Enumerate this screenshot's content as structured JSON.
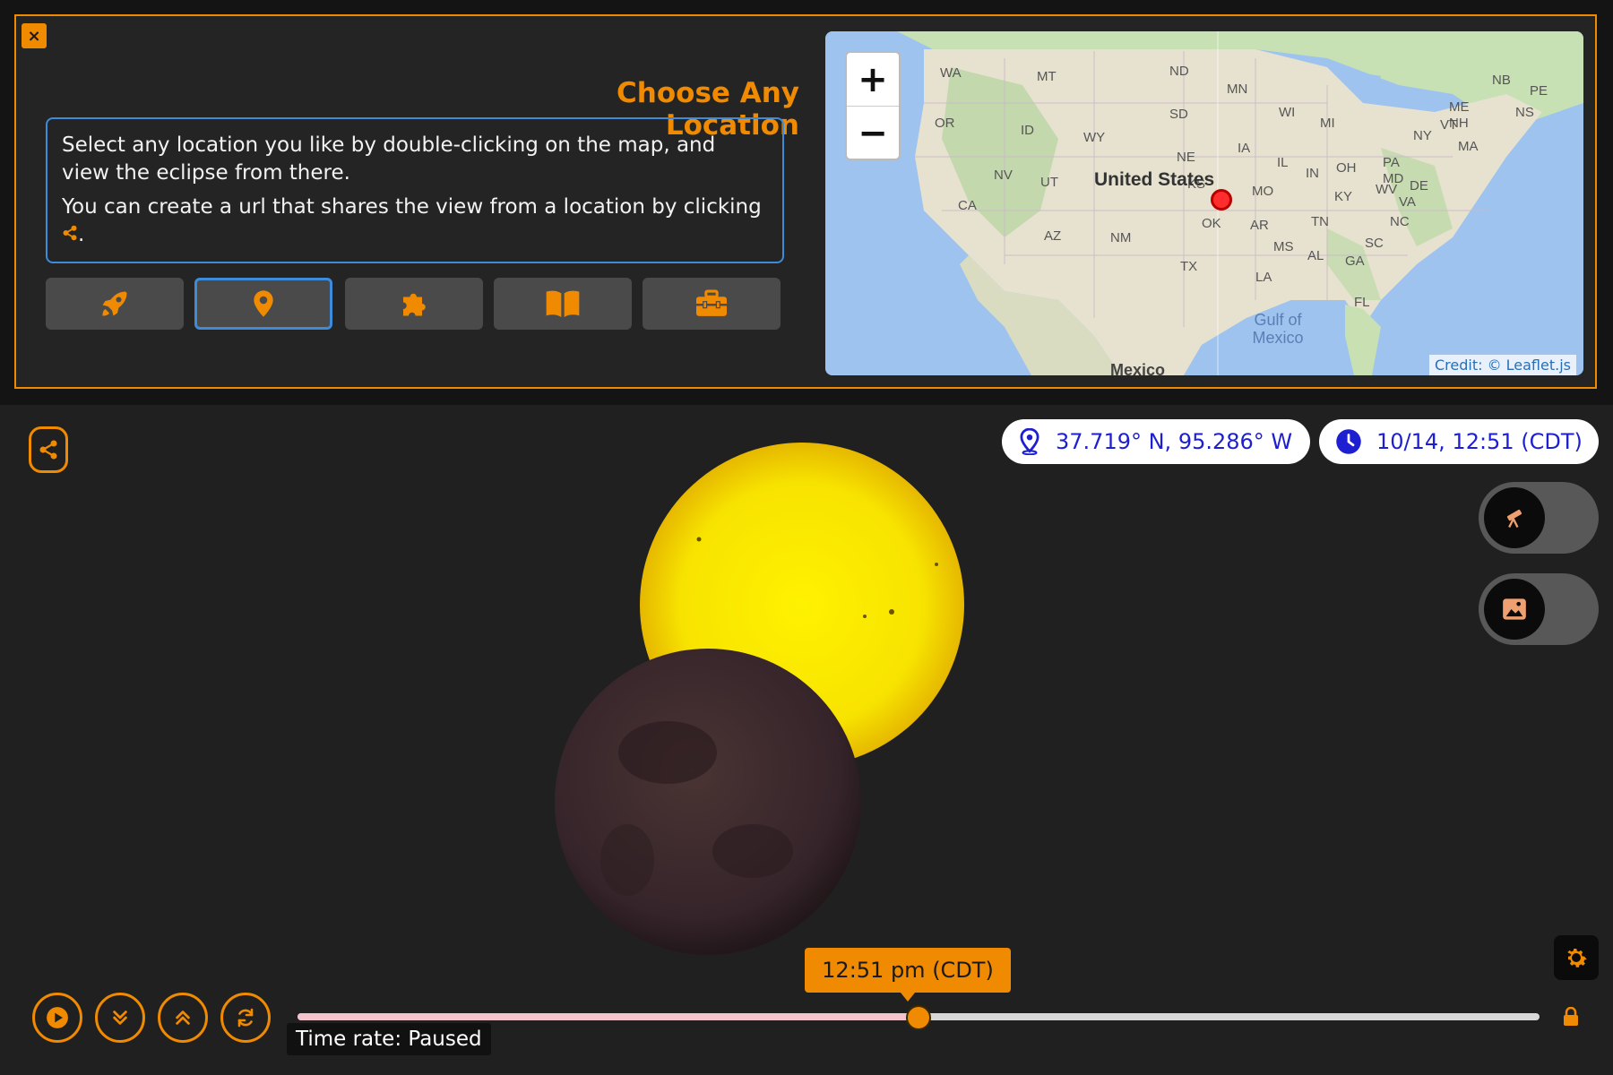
{
  "dialog": {
    "close_label": "×",
    "title": "Choose Any Location",
    "para1": "Select any location you like by double-clicking on the map, and view the eclipse from there.",
    "para2_text": "You can create a url that shares the view from a location by clicking",
    "para2_end": ".",
    "tabs": [
      {
        "icon": "rocket-icon",
        "active": false
      },
      {
        "icon": "map-pin-icon",
        "active": true
      },
      {
        "icon": "puzzle-icon",
        "active": false
      },
      {
        "icon": "book-icon",
        "active": false
      },
      {
        "icon": "toolbox-icon",
        "active": false
      }
    ]
  },
  "map": {
    "zoom_in": "+",
    "zoom_out": "−",
    "credit": "Credit: © Leaflet.js",
    "country_label": "United States",
    "state_labels": [
      "WA",
      "MT",
      "ND",
      "MN",
      "OR",
      "ID",
      "SD",
      "WI",
      "MI",
      "NY",
      "VT",
      "NH",
      "ME",
      "NB",
      "PE",
      "NS",
      "MA",
      "WY",
      "NE",
      "IA",
      "IL",
      "IN",
      "OH",
      "PA",
      "MD",
      "DE",
      "NV",
      "UT",
      "CA",
      "MO",
      "KY",
      "WV",
      "VA",
      "KS",
      "OK",
      "AR",
      "TN",
      "NC",
      "AZ",
      "NM",
      "MS",
      "AL",
      "GA",
      "SC",
      "TX",
      "LA",
      "FL"
    ],
    "water_label": "Gulf of Mexico",
    "mexico_label": "Mexico",
    "marker_color": "#ff2d2d"
  },
  "location": {
    "text": "37.719° N, 95.286° W"
  },
  "datetime": {
    "text": "10/14, 12:51 (CDT)"
  },
  "toggles": [
    {
      "icon": "telescope-icon",
      "on": false
    },
    {
      "icon": "image-icon",
      "on": false
    }
  ],
  "playback": {
    "buttons": [
      "play-icon",
      "slow-down-icon",
      "speed-up-icon",
      "reset-icon"
    ],
    "time_tooltip": "12:51 pm (CDT)",
    "time_rate": "Time rate: Paused",
    "progress": 0.5
  },
  "colors": {
    "accent": "#f08a00",
    "link_blue": "#1d1fd0",
    "panel_border": "#3d8bd9",
    "sun": "#f5e600",
    "moon": "#3b2a29"
  }
}
